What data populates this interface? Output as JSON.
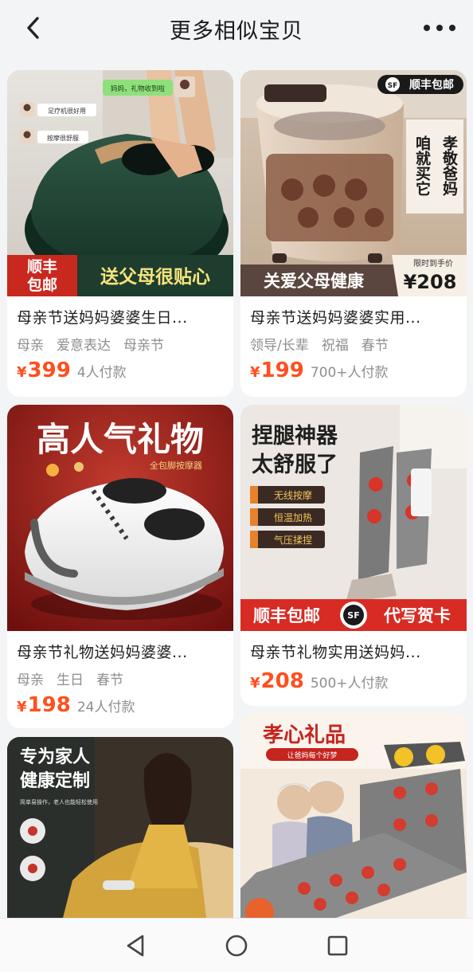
{
  "header": {
    "title": "更多相似宝贝"
  },
  "products": [
    {
      "name": "母亲节送妈妈婆婆生日...",
      "tags": [
        "母亲",
        "爱意表达",
        "母亲节"
      ],
      "currency": "¥",
      "price": "399",
      "buyers": "4人付款",
      "badge_top": "顺丰",
      "badge_bottom": "包邮",
      "banner": "送父母很贴心",
      "chat_top": "妈妈，礼物收到啦",
      "chat_a": "足疗机很好用",
      "chat_b": "按摩很舒服"
    },
    {
      "name": "母亲节送妈妈婆婆实用...",
      "tags": [
        "领导/长辈",
        "祝福",
        "春节"
      ],
      "currency": "¥",
      "price": "199",
      "buyers": "700+人付款",
      "badge": "顺丰包邮",
      "side_a": "孝敬爸妈",
      "side_b": "咱就买它",
      "banner": "关爱父母健康",
      "promo_label": "限时到手价",
      "promo_price": "¥208"
    },
    {
      "name": "母亲节礼物送妈妈婆婆...",
      "tags": [
        "母亲",
        "生日",
        "春节"
      ],
      "currency": "¥",
      "price": "198",
      "buyers": "24人付款",
      "headline": "高人气礼物",
      "sub": "全包脚按摩器"
    },
    {
      "name": "母亲节礼物实用送妈妈...",
      "tags": [],
      "currency": "¥",
      "price": "208",
      "buyers": "500+人付款",
      "headline_a": "捏腿神器",
      "headline_b": "太舒服了",
      "features": [
        "无线按摩",
        "恒温加热",
        "气压揉捏"
      ],
      "banner_left": "顺丰包邮",
      "banner_right": "代写贺卡"
    },
    {
      "headline_a": "专为家人",
      "headline_b": "健康定制",
      "sub": "简单易操作，老人也能轻松使用"
    },
    {
      "headline": "孝心礼品",
      "sub": "让爸妈每个好梦"
    }
  ],
  "colors": {
    "price": "#ff4f1f",
    "accent_red": "#c6241f",
    "background": "#f3f4f6"
  }
}
